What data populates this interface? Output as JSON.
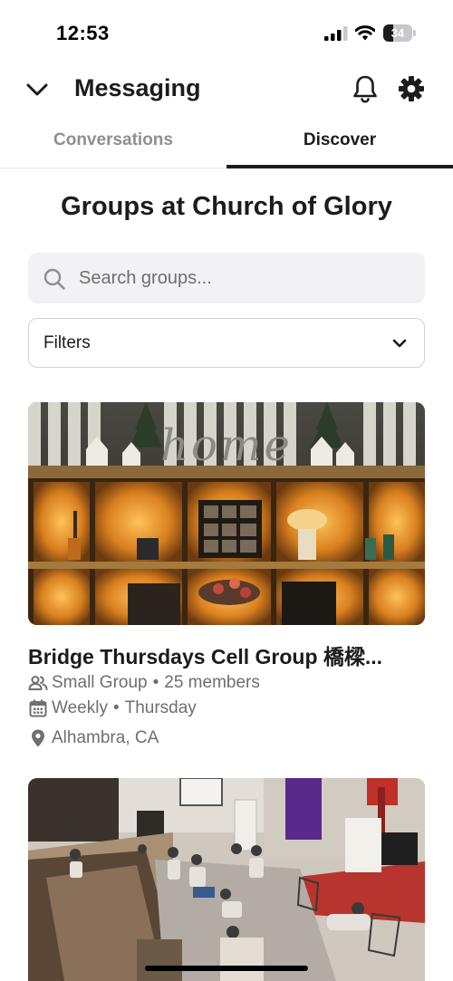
{
  "status_bar": {
    "time": "12:53",
    "battery_level": "34",
    "battery_fraction": 0.34,
    "icons": [
      "signal-icon",
      "wifi-icon",
      "battery-icon"
    ]
  },
  "header": {
    "title": "Messaging",
    "icons": [
      "chevron-down-icon",
      "bell-icon",
      "gear-icon"
    ]
  },
  "tabs": [
    {
      "label": "Conversations",
      "active": false
    },
    {
      "label": "Discover",
      "active": true
    }
  ],
  "heading": "Groups at Church of Glory",
  "search": {
    "value": "",
    "placeholder": "Search groups..."
  },
  "filters": {
    "label": "Filters"
  },
  "groups": [
    {
      "name": "Bridge Thursdays Cell Group 橋樑...",
      "type": "Small Group",
      "members": "25 members",
      "frequency": "Weekly",
      "day": "Thursday",
      "location": "Alhambra, CA",
      "photo_letters": "home"
    },
    {}
  ],
  "colors": {
    "text_primary": "#1c1c1e",
    "text_secondary": "#6e6e73",
    "tab_inactive": "#8e8e93",
    "search_bg": "#f2f2f4",
    "border": "#d1d1d6"
  }
}
